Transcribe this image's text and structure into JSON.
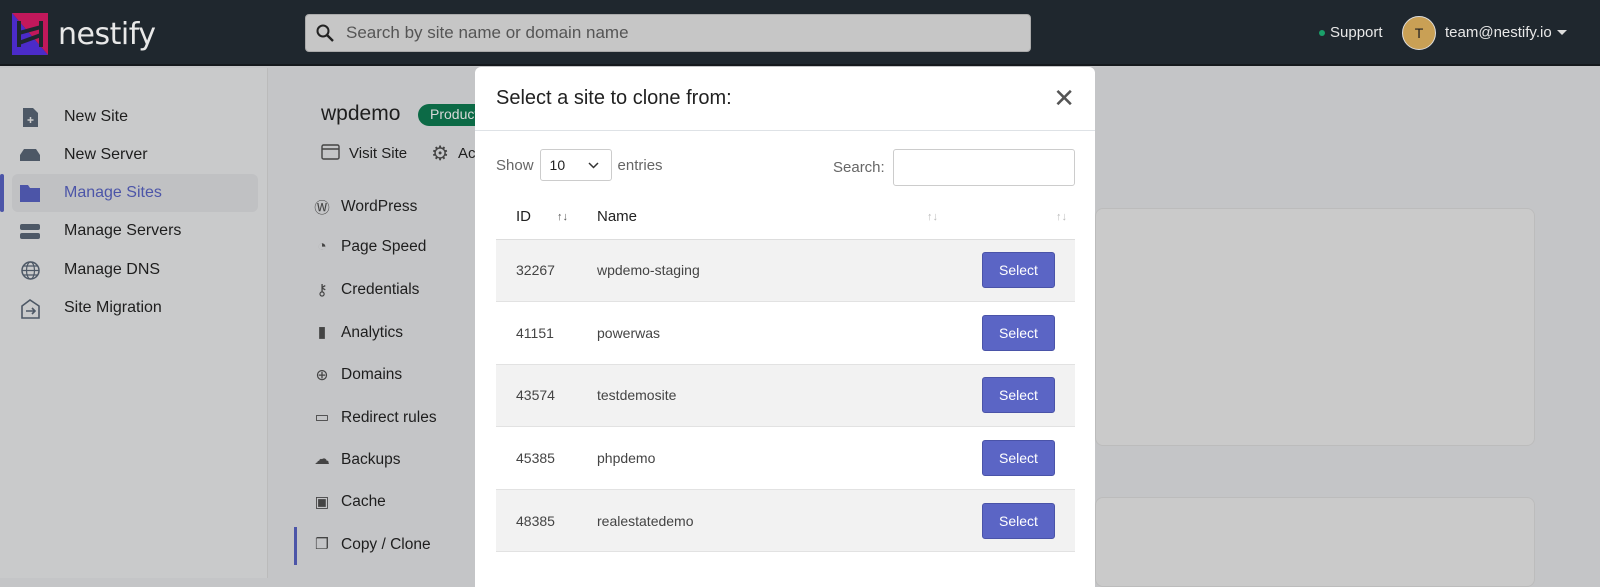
{
  "header": {
    "brand": "nestify",
    "search_placeholder": "Search by site name or domain name",
    "support": "Support",
    "avatar_initial": "T",
    "user_email": "team@nestify.io"
  },
  "sidebar": {
    "items": [
      {
        "label": "New Site",
        "icon": "file-plus-icon"
      },
      {
        "label": "New Server",
        "icon": "server-drive-icon"
      },
      {
        "label": "Manage Sites",
        "icon": "folder-icon",
        "active": true
      },
      {
        "label": "Manage Servers",
        "icon": "servers-icon"
      },
      {
        "label": "Manage DNS",
        "icon": "globe-icon"
      },
      {
        "label": "Site Migration",
        "icon": "migration-icon"
      }
    ]
  },
  "site": {
    "name": "wpdemo",
    "badge": "Production",
    "visit": "Visit Site",
    "actions": "Actions"
  },
  "site_nav": [
    {
      "label": "WordPress"
    },
    {
      "label": "Page Speed"
    },
    {
      "label": "Credentials"
    },
    {
      "label": "Analytics"
    },
    {
      "label": "Domains"
    },
    {
      "label": "Redirect rules"
    },
    {
      "label": "Backups"
    },
    {
      "label": "Cache"
    },
    {
      "label": "Copy / Clone",
      "active": true
    }
  ],
  "modal": {
    "title": "Select a site to clone from:",
    "show": "Show",
    "entries_value": "10",
    "entries": "entries",
    "search_label": "Search:",
    "columns": [
      "ID",
      "Name",
      ""
    ],
    "rows": [
      {
        "id": "32267",
        "name": "wpdemo-staging"
      },
      {
        "id": "41151",
        "name": "powerwas"
      },
      {
        "id": "43574",
        "name": "testdemosite"
      },
      {
        "id": "45385",
        "name": "phpdemo"
      },
      {
        "id": "48385",
        "name": "realestatedemo"
      }
    ],
    "select_label": "Select"
  },
  "colors": {
    "accent": "#5b65c5",
    "topbar": "#1f272e",
    "badge": "#0c6a46"
  }
}
